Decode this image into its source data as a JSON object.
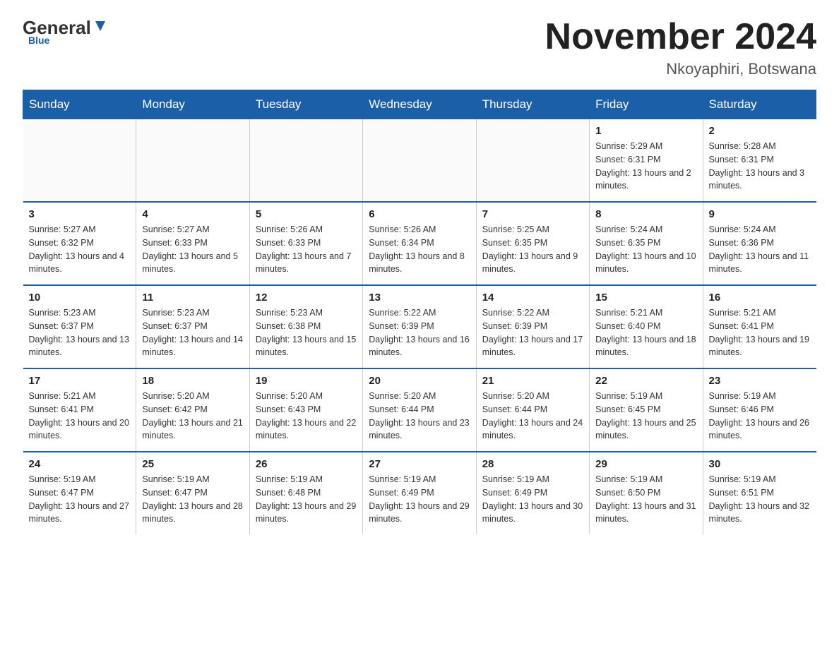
{
  "logo": {
    "general": "General",
    "blue": "Blue",
    "tagline": "Blue"
  },
  "title": "November 2024",
  "subtitle": "Nkoyaphiri, Botswana",
  "headers": [
    "Sunday",
    "Monday",
    "Tuesday",
    "Wednesday",
    "Thursday",
    "Friday",
    "Saturday"
  ],
  "weeks": [
    [
      {
        "day": "",
        "info": ""
      },
      {
        "day": "",
        "info": ""
      },
      {
        "day": "",
        "info": ""
      },
      {
        "day": "",
        "info": ""
      },
      {
        "day": "",
        "info": ""
      },
      {
        "day": "1",
        "info": "Sunrise: 5:29 AM\nSunset: 6:31 PM\nDaylight: 13 hours and 2 minutes."
      },
      {
        "day": "2",
        "info": "Sunrise: 5:28 AM\nSunset: 6:31 PM\nDaylight: 13 hours and 3 minutes."
      }
    ],
    [
      {
        "day": "3",
        "info": "Sunrise: 5:27 AM\nSunset: 6:32 PM\nDaylight: 13 hours and 4 minutes."
      },
      {
        "day": "4",
        "info": "Sunrise: 5:27 AM\nSunset: 6:33 PM\nDaylight: 13 hours and 5 minutes."
      },
      {
        "day": "5",
        "info": "Sunrise: 5:26 AM\nSunset: 6:33 PM\nDaylight: 13 hours and 7 minutes."
      },
      {
        "day": "6",
        "info": "Sunrise: 5:26 AM\nSunset: 6:34 PM\nDaylight: 13 hours and 8 minutes."
      },
      {
        "day": "7",
        "info": "Sunrise: 5:25 AM\nSunset: 6:35 PM\nDaylight: 13 hours and 9 minutes."
      },
      {
        "day": "8",
        "info": "Sunrise: 5:24 AM\nSunset: 6:35 PM\nDaylight: 13 hours and 10 minutes."
      },
      {
        "day": "9",
        "info": "Sunrise: 5:24 AM\nSunset: 6:36 PM\nDaylight: 13 hours and 11 minutes."
      }
    ],
    [
      {
        "day": "10",
        "info": "Sunrise: 5:23 AM\nSunset: 6:37 PM\nDaylight: 13 hours and 13 minutes."
      },
      {
        "day": "11",
        "info": "Sunrise: 5:23 AM\nSunset: 6:37 PM\nDaylight: 13 hours and 14 minutes."
      },
      {
        "day": "12",
        "info": "Sunrise: 5:23 AM\nSunset: 6:38 PM\nDaylight: 13 hours and 15 minutes."
      },
      {
        "day": "13",
        "info": "Sunrise: 5:22 AM\nSunset: 6:39 PM\nDaylight: 13 hours and 16 minutes."
      },
      {
        "day": "14",
        "info": "Sunrise: 5:22 AM\nSunset: 6:39 PM\nDaylight: 13 hours and 17 minutes."
      },
      {
        "day": "15",
        "info": "Sunrise: 5:21 AM\nSunset: 6:40 PM\nDaylight: 13 hours and 18 minutes."
      },
      {
        "day": "16",
        "info": "Sunrise: 5:21 AM\nSunset: 6:41 PM\nDaylight: 13 hours and 19 minutes."
      }
    ],
    [
      {
        "day": "17",
        "info": "Sunrise: 5:21 AM\nSunset: 6:41 PM\nDaylight: 13 hours and 20 minutes."
      },
      {
        "day": "18",
        "info": "Sunrise: 5:20 AM\nSunset: 6:42 PM\nDaylight: 13 hours and 21 minutes."
      },
      {
        "day": "19",
        "info": "Sunrise: 5:20 AM\nSunset: 6:43 PM\nDaylight: 13 hours and 22 minutes."
      },
      {
        "day": "20",
        "info": "Sunrise: 5:20 AM\nSunset: 6:44 PM\nDaylight: 13 hours and 23 minutes."
      },
      {
        "day": "21",
        "info": "Sunrise: 5:20 AM\nSunset: 6:44 PM\nDaylight: 13 hours and 24 minutes."
      },
      {
        "day": "22",
        "info": "Sunrise: 5:19 AM\nSunset: 6:45 PM\nDaylight: 13 hours and 25 minutes."
      },
      {
        "day": "23",
        "info": "Sunrise: 5:19 AM\nSunset: 6:46 PM\nDaylight: 13 hours and 26 minutes."
      }
    ],
    [
      {
        "day": "24",
        "info": "Sunrise: 5:19 AM\nSunset: 6:47 PM\nDaylight: 13 hours and 27 minutes."
      },
      {
        "day": "25",
        "info": "Sunrise: 5:19 AM\nSunset: 6:47 PM\nDaylight: 13 hours and 28 minutes."
      },
      {
        "day": "26",
        "info": "Sunrise: 5:19 AM\nSunset: 6:48 PM\nDaylight: 13 hours and 29 minutes."
      },
      {
        "day": "27",
        "info": "Sunrise: 5:19 AM\nSunset: 6:49 PM\nDaylight: 13 hours and 29 minutes."
      },
      {
        "day": "28",
        "info": "Sunrise: 5:19 AM\nSunset: 6:49 PM\nDaylight: 13 hours and 30 minutes."
      },
      {
        "day": "29",
        "info": "Sunrise: 5:19 AM\nSunset: 6:50 PM\nDaylight: 13 hours and 31 minutes."
      },
      {
        "day": "30",
        "info": "Sunrise: 5:19 AM\nSunset: 6:51 PM\nDaylight: 13 hours and 32 minutes."
      }
    ]
  ]
}
